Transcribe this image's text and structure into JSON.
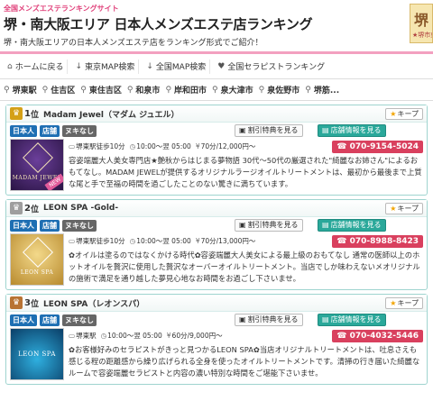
{
  "header": {
    "tagline": "全国メンズエステランキングサイト",
    "title": "堺・南大阪エリア 日本人メンズエステ店ランキング",
    "subtitle": "堺・南大阪エリアの日本人メンズエステ店をランキング形式でご紹介！",
    "logo_char": "堺",
    "logo_sub": "★堺市東"
  },
  "nav": [
    {
      "icon": "home-icon",
      "glyph": "⌂",
      "label": "ホームに戻る"
    },
    {
      "icon": "down-arrow-icon",
      "glyph": "↓",
      "label": "東京MAP検索"
    },
    {
      "icon": "down-arrow-icon",
      "glyph": "↓",
      "label": "全国MAP検索"
    },
    {
      "icon": "heart-icon",
      "glyph": "♥",
      "label": "全国セラピストランキング"
    }
  ],
  "areas": [
    "堺東駅",
    "住吉区",
    "東住吉区",
    "和泉市",
    "岸和田市",
    "泉大津市",
    "泉佐野市",
    "堺筋..."
  ],
  "area_icon": "map-pin-icon",
  "keep_label": "キープ",
  "coupon_label": "割引特典を見る",
  "detail_label": "店舗情報を見る",
  "shops": [
    {
      "rank_num": "1",
      "rank_suffix": "位",
      "rank_color": "#d4a017",
      "name": "Madam Jewel（マダム ジュエル）",
      "tags": [
        "日本人",
        "店舗",
        "ヌキなし"
      ],
      "station": "堺東駅徒歩10分",
      "hours": "10:00〜翌 05:00",
      "price": "70分/12,000円〜",
      "tel": "070-9154-5024",
      "desc": "容姿端麗大人美女専門店★艶秋からはじまる夢物語 30代〜50代の厳選された\"綺麗なお姉さん\"によるおもてなし。MADAM JEWELが提供するオリジナルラージオイルトリートメントは、最初から最後まで上質な尾と手で至福の時間を過ごしたことのない驚きに満ちています。",
      "thumb_text": "MADAM JEWEL",
      "thumb_bg": "#3a1f5a",
      "new_badge": "NEW"
    },
    {
      "rank_num": "2",
      "rank_suffix": "位",
      "rank_color": "#9e9e9e",
      "name": "LEON SPA -Gold-",
      "tags": [
        "日本人",
        "店舗",
        "ヌキなし"
      ],
      "station": "堺東駅徒歩10分",
      "hours": "10:00〜翌 05:00",
      "price": "70分/13,000円〜",
      "tel": "070-8988-8423",
      "desc": "✿オイルは塗るのではなくかける時代✿容姿端麗大人美女による最上級のおもてなし 通常の医師以上のホットオイルを贅沢に使用した贅沢なオーバーオイルトリートメント。当店でしか味わえないメオリジナルの施術で満足を通り越した夢見心地なお時間をお過ごし下さいませ。",
      "thumb_text": "LEON SPA",
      "thumb_bg": "#caa24a",
      "new_badge": ""
    },
    {
      "rank_num": "3",
      "rank_suffix": "位",
      "rank_color": "#b87333",
      "name": "LEON SPA（レオンスパ）",
      "tags": [
        "日本人",
        "店舗",
        "ヌキなし"
      ],
      "station": "堺東駅",
      "hours": "10:00〜翌 05:00",
      "price": "60分/9,000円〜",
      "tel": "070-4032-5446",
      "desc": "✿お客様好みのセラピストがきっと見つかるLEON SPA✿当店オリジナルトリートメントは、吐息さえも感じる程の距離感から繰り広げられる全身を使ったオイルトリートメントです。清掃の行き届いた綺麗なルームで容姿端麗セラピストと内容の濃い特別な時間をご堪能下さいませ。",
      "thumb_text": "LEON SPA",
      "thumb_bg": "#0b5a8c",
      "new_badge": ""
    }
  ]
}
